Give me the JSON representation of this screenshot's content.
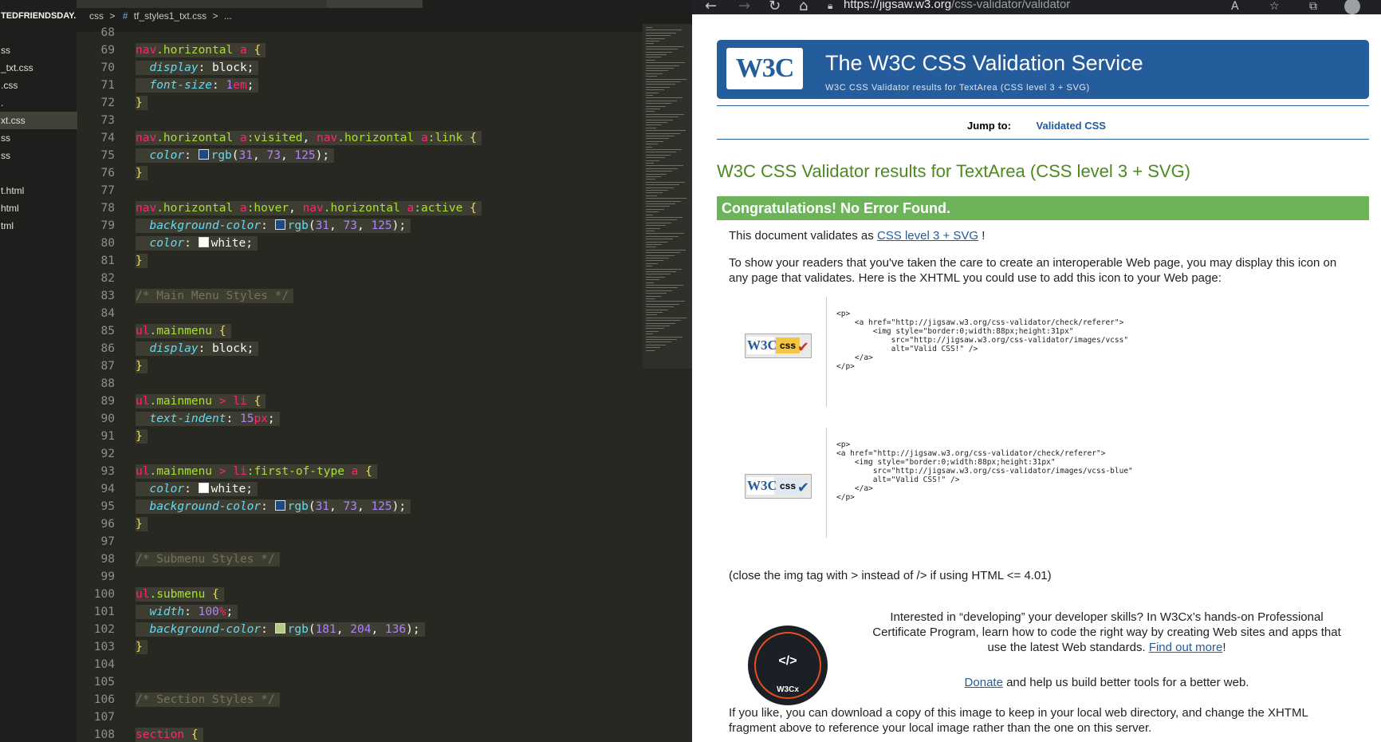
{
  "editor": {
    "explorer": {
      "title": "TEDFRIENDSDAY...",
      "files": [
        "ss",
        "_txt.css",
        ".css",
        ".",
        "xt.css",
        "ss",
        "ss",
        "",
        "t.html",
        "html",
        "tml"
      ],
      "active_index": 4
    },
    "breadcrumbs": [
      "css",
      ">",
      "#",
      "tf_styles1_txt.css",
      ">",
      "..."
    ],
    "lines": [
      {
        "n": "68",
        "t": ""
      },
      {
        "n": "69",
        "t": "nav.horizontal a {"
      },
      {
        "n": "70",
        "t": "  display: block;"
      },
      {
        "n": "71",
        "t": "  font-size: 1em;"
      },
      {
        "n": "72",
        "t": "}"
      },
      {
        "n": "73",
        "t": ""
      },
      {
        "n": "74",
        "t": "nav.horizontal a:visited, nav.horizontal a:link {"
      },
      {
        "n": "75",
        "t": "  color: rgb(31, 73, 125);"
      },
      {
        "n": "76",
        "t": "}"
      },
      {
        "n": "77",
        "t": ""
      },
      {
        "n": "78",
        "t": "nav.horizontal a:hover, nav.horizontal a:active {"
      },
      {
        "n": "79",
        "t": "  background-color: rgb(31, 73, 125);"
      },
      {
        "n": "80",
        "t": "  color: white;"
      },
      {
        "n": "81",
        "t": "}"
      },
      {
        "n": "82",
        "t": ""
      },
      {
        "n": "83",
        "t": "/* Main Menu Styles */"
      },
      {
        "n": "84",
        "t": ""
      },
      {
        "n": "85",
        "t": "ul.mainmenu {"
      },
      {
        "n": "86",
        "t": "  display: block;"
      },
      {
        "n": "87",
        "t": "}"
      },
      {
        "n": "88",
        "t": ""
      },
      {
        "n": "89",
        "t": "ul.mainmenu > li {"
      },
      {
        "n": "90",
        "t": "  text-indent: 15px;"
      },
      {
        "n": "91",
        "t": "}"
      },
      {
        "n": "92",
        "t": ""
      },
      {
        "n": "93",
        "t": "ul.mainmenu > li:first-of-type a {"
      },
      {
        "n": "94",
        "t": "  color: white;"
      },
      {
        "n": "95",
        "t": "  background-color: rgb(31, 73, 125);"
      },
      {
        "n": "96",
        "t": "}"
      },
      {
        "n": "97",
        "t": ""
      },
      {
        "n": "98",
        "t": "/* Submenu Styles */"
      },
      {
        "n": "99",
        "t": ""
      },
      {
        "n": "100",
        "t": "ul.submenu {"
      },
      {
        "n": "101",
        "t": "  width: 100%;"
      },
      {
        "n": "102",
        "t": "  background-color: rgb(181, 204, 136);"
      },
      {
        "n": "103",
        "t": "}"
      },
      {
        "n": "104",
        "t": ""
      },
      {
        "n": "105",
        "t": ""
      },
      {
        "n": "106",
        "t": "/* Section Styles */"
      },
      {
        "n": "107",
        "t": ""
      },
      {
        "n": "108",
        "t": "section {"
      }
    ]
  },
  "browser": {
    "url_host": "https://jigsaw.w3.org",
    "url_path": "/css-validator/validator",
    "banner": {
      "logo_text": "W3C",
      "title": "The W3C CSS Validation Service",
      "subtitle": "W3C CSS Validator results for TextArea (CSS level 3 + SVG)"
    },
    "jump": {
      "label": "Jump to:",
      "link": "Validated CSS"
    },
    "results_title": "W3C CSS Validator results for TextArea (CSS level 3 + SVG)",
    "congrats": "Congratulations! No Error Found.",
    "validates_prefix": "This document validates as ",
    "validates_link": "CSS level 3 + SVG",
    "validates_suffix": " !",
    "readers_text": "To show your readers that you've taken the care to create an interoperable Web page, you may display this icon on any page that validates. Here is the XHTML you could use to add this icon to your Web page:",
    "code1": "<p>\n    <a href=\"http://jigsaw.w3.org/css-validator/check/referer\">\n        <img style=\"border:0;width:88px;height:31px\"\n            src=\"http://jigsaw.w3.org/css-validator/images/vcss\"\n            alt=\"Valid CSS!\" />\n    </a>\n</p>",
    "code2": "<p>\n<a href=\"http://jigsaw.w3.org/css-validator/check/referer\">\n    <img style=\"border:0;width:88px;height:31px\"\n        src=\"http://jigsaw.w3.org/css-validator/images/vcss-blue\"\n        alt=\"Valid CSS!\" />\n    </a>\n</p>",
    "badge1": {
      "w3": "W3C",
      "css": "css"
    },
    "badge2": {
      "w3": "W3C",
      "css": "css"
    },
    "close_tag_note": "(close the img tag with > instead of /> if using HTML <= 4.01)",
    "cert_logo_text": "W3Cx",
    "interested_text": "Interested in “developing” your developer skills? In W3Cx’s hands-on Professional Certificate Program, learn how to code the right way by creating Web sites and apps that use the latest Web standards.",
    "find_out_more": "Find out more",
    "find_out_suffix": "!",
    "donate_link": "Donate",
    "donate_rest": " and help us build better tools for a better web.",
    "download_text": "If you like, you can download a copy of this image to keep in your local web directory, and change the XHTML fragment above to reference your local image rather than the one on this server."
  },
  "colors": {
    "editor_bg": "#272822",
    "banner_blue": "#245c9c",
    "congrats_green": "#6cb35a",
    "swatch_blue": "#1f497d",
    "swatch_white": "#ffffff",
    "swatch_green": "#b5cc88"
  }
}
